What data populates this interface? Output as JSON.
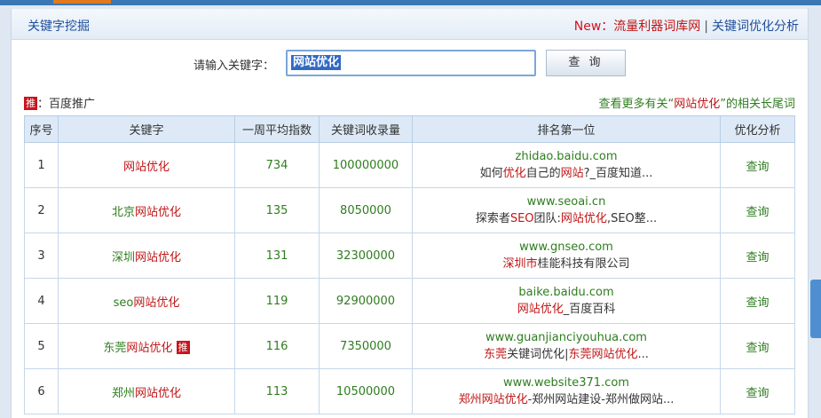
{
  "header": {
    "title": "关键字挖掘",
    "new_label": "New：",
    "link1": "流量利器词库网",
    "separator": "|",
    "link2": "关键词优化分析"
  },
  "search": {
    "label": "请输入关键字：",
    "value": "网站优化",
    "button": "查 询"
  },
  "promo": {
    "badge": "推",
    "text": "：百度推广"
  },
  "more_link": {
    "prefix": "查看更多有关“",
    "keyword": "网站优化",
    "suffix": "”的相关长尾词"
  },
  "table": {
    "headers": [
      "序号",
      "关键字",
      "一周平均指数",
      "关键词收录量",
      "排名第一位",
      "优化分析"
    ],
    "rows": [
      {
        "idx": "1",
        "kw_pre": "",
        "kw_red": "网站优化",
        "badge": "",
        "index": "734",
        "count": "100000000",
        "domain": "zhidao.baidu.com",
        "desc": [
          {
            "t": "如何",
            "r": false
          },
          {
            "t": "优化",
            "r": true
          },
          {
            "t": "自己的",
            "r": false
          },
          {
            "t": "网站",
            "r": true
          },
          {
            "t": "?_百度知道...",
            "r": false
          }
        ],
        "action": "查询"
      },
      {
        "idx": "2",
        "kw_pre": "北京",
        "kw_red": "网站优化",
        "badge": "",
        "index": "135",
        "count": "8050000",
        "domain": "www.seoai.cn",
        "desc": [
          {
            "t": "探索者",
            "r": false
          },
          {
            "t": "SEO",
            "r": true
          },
          {
            "t": "团队:",
            "r": false
          },
          {
            "t": "网站优化",
            "r": true
          },
          {
            "t": ",SEO整...",
            "r": false
          }
        ],
        "action": "查询"
      },
      {
        "idx": "3",
        "kw_pre": "深圳",
        "kw_red": "网站优化",
        "badge": "",
        "index": "131",
        "count": "32300000",
        "domain": "www.gnseo.com",
        "desc": [
          {
            "t": "深圳市",
            "r": true
          },
          {
            "t": "桂能科技有限公司",
            "r": false
          }
        ],
        "action": "查询"
      },
      {
        "idx": "4",
        "kw_pre": "seo",
        "kw_red": "网站优化",
        "badge": "",
        "index": "119",
        "count": "92900000",
        "domain": "baike.baidu.com",
        "desc": [
          {
            "t": "网站优化",
            "r": true
          },
          {
            "t": "_百度百科",
            "r": false
          }
        ],
        "action": "查询"
      },
      {
        "idx": "5",
        "kw_pre": "东莞",
        "kw_red": "网站优化",
        "badge": "推",
        "index": "116",
        "count": "7350000",
        "domain": "www.guanjianciyouhua.com",
        "desc": [
          {
            "t": "东莞",
            "r": true
          },
          {
            "t": "关键词优化|",
            "r": false
          },
          {
            "t": "东莞网站优化",
            "r": true
          },
          {
            "t": "...",
            "r": false
          }
        ],
        "action": "查询"
      },
      {
        "idx": "6",
        "kw_pre": "郑州",
        "kw_red": "网站优化",
        "badge": "",
        "index": "113",
        "count": "10500000",
        "domain": "www.website371.com",
        "desc": [
          {
            "t": "郑州网站优化",
            "r": true
          },
          {
            "t": "-郑州网站建设-郑州做网站...",
            "r": false
          }
        ],
        "action": "查询"
      }
    ]
  }
}
